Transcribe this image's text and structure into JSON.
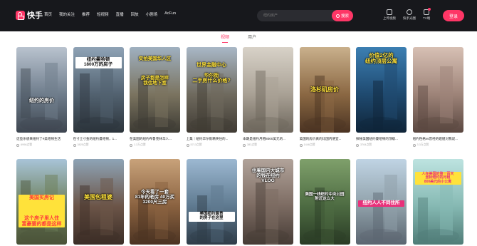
{
  "app": {
    "logo_text": "快手"
  },
  "nav": [
    "首页",
    "我的关注",
    "推荐",
    "短视频",
    "直播",
    "回放",
    "小剧场",
    "AcFun"
  ],
  "search": {
    "placeholder": "纽约房产",
    "button": "搜索"
  },
  "tools": [
    {
      "label": "上传视频",
      "icon": "upload-icon"
    },
    {
      "label": "快手光圈",
      "icon": "aperture-icon"
    },
    {
      "label": "TV端",
      "icon": "tv-icon"
    }
  ],
  "login_label": "登录",
  "tabs": [
    {
      "label": "视频",
      "active": true
    },
    {
      "label": "用户",
      "active": false
    }
  ],
  "row1": [
    {
      "caption": "纽约的房价",
      "title": "这些乐想来纽约了#美哈顿生活",
      "likes": "6998点赞",
      "colors": [
        "#b9c3cf",
        "#6f7d8c",
        "#3e4650"
      ]
    },
    {
      "caption": "纽约曼哈顿\n1800万的房子",
      "title": "在寸土寸金的纽约曼哈顿，1...",
      "likes": "3825点赞",
      "colors": [
        "#8fa3b6",
        "#526270",
        "#2c343b"
      ]
    },
    {
      "caption": "实拍美国华人区\n\n\n\n房子都是怎样\n我住地下室",
      "title": "在美国的纽约布鲁克林华人...",
      "likes": "1.3万点赞",
      "colors": [
        "#9fb0c0",
        "#7b7460",
        "#3c3a33"
      ]
    },
    {
      "caption": "世界金融中心\n\n华尔街\n二手房什么价格?",
      "title": "上集｜纽约华尔街精英住的...",
      "likes": "5713点赞",
      "colors": [
        "#a9b8c7",
        "#6f6a5e",
        "#403b34"
      ]
    },
    {
      "caption": "",
      "title": "本期是纽约月租8000美元的...",
      "likes": "383点赞",
      "colors": [
        "#d8d2c8",
        "#a9a195",
        "#6d665c"
      ]
    },
    {
      "caption": "洛杉矶房价",
      "title": "美国的房价真的比国内便宜...",
      "likes": "1446点赞",
      "colors": [
        "#c9b08c",
        "#8b6843",
        "#4a3322"
      ]
    },
    {
      "caption": "价值2亿的\n纽约顶层公寓",
      "title": "探秘美国纽约曼哈顿的顶级...",
      "likes": "3764点赞",
      "colors": [
        "#3c7fb3",
        "#1f4a70",
        "#0f2438"
      ]
    },
    {
      "caption": "",
      "title": "纽约性格vs曾经的姐姐对我说...",
      "likes": "3.3万点赞",
      "colors": [
        "#d7c0b4",
        "#9e8479",
        "#5a4740"
      ]
    }
  ],
  "row2": [
    {
      "caption": "美国买房记\n\n\n\n这个房子里人住\n富豪要的都是这样",
      "colors": [
        "#a8c4d8",
        "#6d7f5a",
        "#4a5238"
      ]
    },
    {
      "caption": "美国包租婆",
      "colors": [
        "#8ea4b6",
        "#6c5548",
        "#3b2d26"
      ]
    },
    {
      "caption": "今天看了一套\n81年的老房 40万买\n3200尺三房",
      "colors": [
        "#c8a27a",
        "#8a6240",
        "#4b3322"
      ]
    },
    {
      "caption": "美国纽约最贵\n的房子在这里",
      "colors": [
        "#9cb8d2",
        "#5f7a90",
        "#2f3c48"
      ]
    },
    {
      "caption": "住着国内大城市\n的钱在纽约\nVLOG",
      "colors": [
        "#b1a39a",
        "#7c6b62",
        "#463b35"
      ]
    },
    {
      "caption": "美国一线纽约中央公园\n附近这么大",
      "colors": [
        "#7fa06b",
        "#4d6b42",
        "#2a3b25"
      ]
    },
    {
      "caption": "纽约人人不同住所",
      "colors": [
        "#c0d4e4",
        "#8fa0a9",
        "#5b6570"
      ]
    },
    {
      "caption": "人在美国的第一百天\n坐标纽约的月租\n800美元的小公寓",
      "colors": [
        "#bde3e0",
        "#86b9b3",
        "#4f7c77"
      ]
    }
  ]
}
